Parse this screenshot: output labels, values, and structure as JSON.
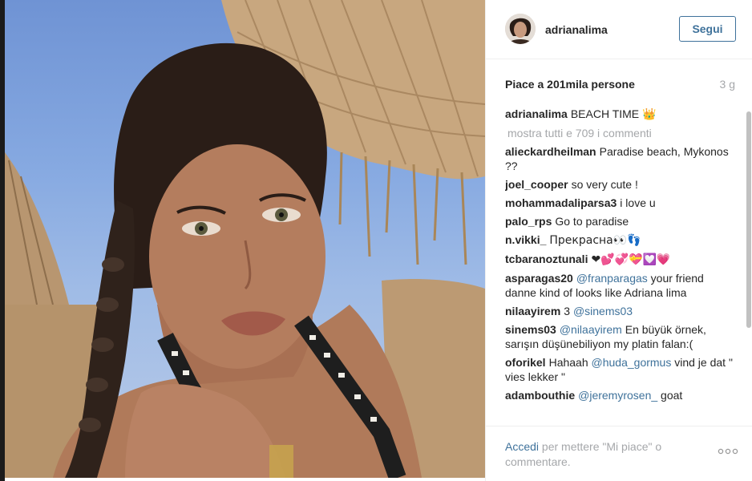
{
  "post": {
    "username": "adrianalima",
    "follow_label": "Segui",
    "likes_text": "Piace a 201mila persone",
    "time_ago": "3 g",
    "caption_user": "adrianalima",
    "caption_text": "BEACH TIME",
    "caption_emoji": "👑",
    "view_all_text": "mostra tutti e 709 i commenti"
  },
  "comments": [
    {
      "user": "alieckardheilman",
      "text": "Paradise beach, Mykonos ??"
    },
    {
      "user": "joel_cooper",
      "text": "so very cute !"
    },
    {
      "user": "mohammadaliparsa3",
      "text": "i love u"
    },
    {
      "user": "palo_rps",
      "text": "Go to paradise"
    },
    {
      "user": "n.vikki_",
      "text": "Прекрасна👀👣"
    },
    {
      "user": "tcbaranoztunali",
      "text": "❤💕💞💝💟💗"
    },
    {
      "user": "asparagas20",
      "mention": "@franparagas",
      "text": "your friend danne kind of looks like Adriana lima"
    },
    {
      "user": "nilaayirem",
      "pre": "3",
      "mention": "@sinems03",
      "text": ""
    },
    {
      "user": "sinems03",
      "mention": "@nilaayirem",
      "text": "En büyük örnek, sarışın düşünebiliyon my platin falan:("
    },
    {
      "user": "oforikel",
      "pre": "Hahaah",
      "mention": "@huda_gormus",
      "text": "vind je dat \" vies lekker \""
    },
    {
      "user": "adambouthie",
      "mention": "@jeremyrosen_",
      "text": "goat"
    }
  ],
  "footer": {
    "login_link": "Accedi",
    "login_rest": " per mettere \"Mi piace\" o commentare.",
    "more_icon": "more-dots-icon",
    "more_label": "ooo"
  },
  "colors": {
    "link_blue": "#3f729b",
    "muted_gray": "#a5a7aa",
    "text": "#262626"
  }
}
